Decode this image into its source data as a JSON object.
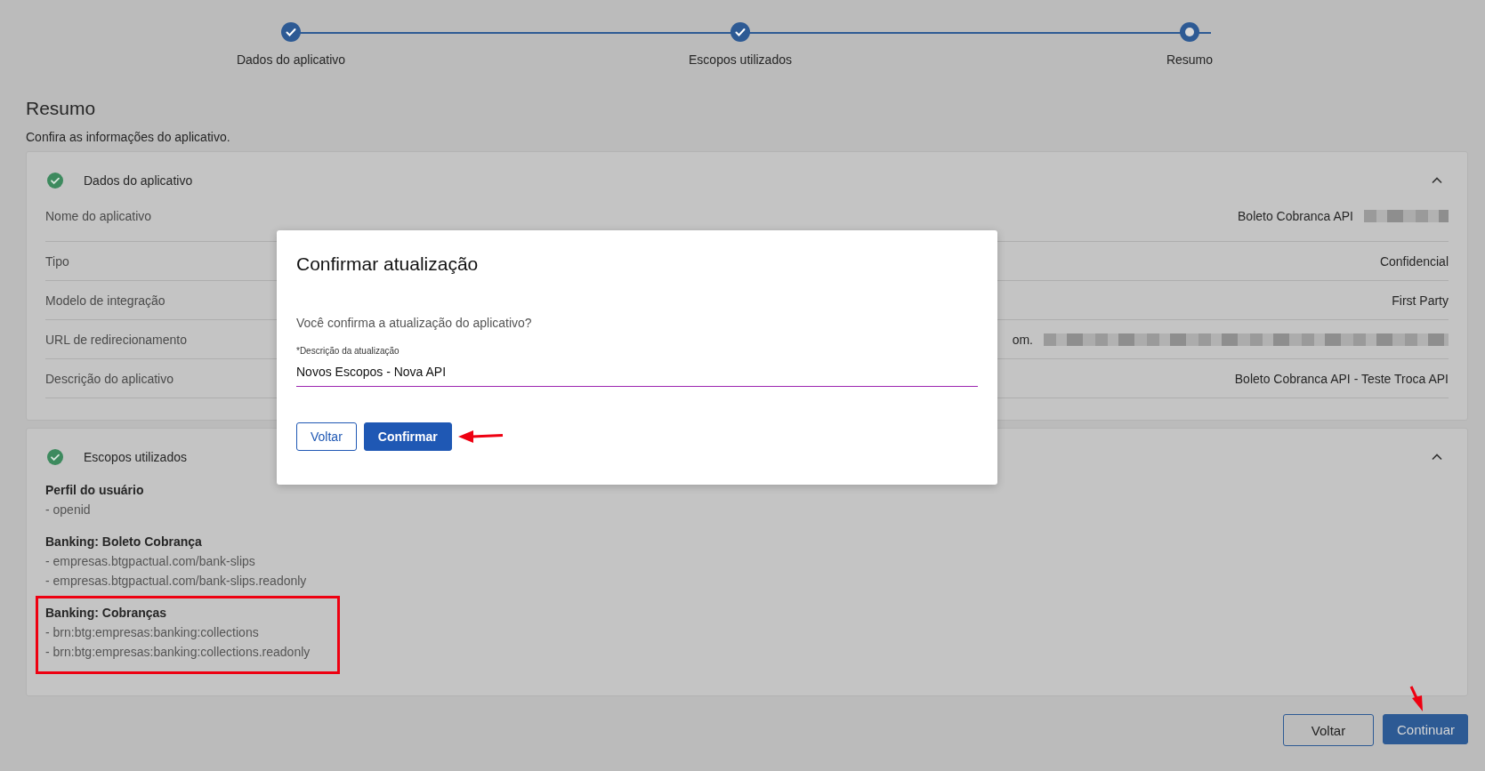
{
  "stepper": {
    "steps": [
      {
        "label": "Dados do aplicativo",
        "completed": true
      },
      {
        "label": "Escopos utilizados",
        "completed": true
      },
      {
        "label": "Resumo",
        "completed": false
      }
    ]
  },
  "page": {
    "title": "Resumo",
    "subtitle": "Confira as informações do aplicativo."
  },
  "sections": [
    {
      "kind": "fields",
      "title": "Dados do aplicativo",
      "complete": true,
      "expanded": true,
      "fields": [
        {
          "label": "Nome do aplicativo",
          "value": "Boleto Cobranca API",
          "redacted": true
        },
        {
          "label": "Tipo",
          "value": "Confidencial",
          "redacted": false
        },
        {
          "label": "Modelo de integração",
          "value": "First Party",
          "redacted": false
        },
        {
          "label": "URL de redirecionamento",
          "value": "om.",
          "redacted": true
        },
        {
          "label": "Descrição do aplicativo",
          "value": "Boleto Cobranca API - Teste Troca API",
          "redacted": false
        }
      ]
    },
    {
      "kind": "scopes",
      "title": "Escopos utilizados",
      "complete": true,
      "expanded": true,
      "groups": [
        {
          "title": "Perfil do usuário",
          "highlighted": false,
          "scopes": [
            "- openid"
          ]
        },
        {
          "title": "Banking: Boleto Cobrança",
          "highlighted": false,
          "scopes": [
            "- empresas.btgpactual.com/bank-slips",
            "- empresas.btgpactual.com/bank-slips.readonly"
          ]
        },
        {
          "title": "Banking: Cobranças",
          "highlighted": true,
          "scopes": [
            "- brn:btg:empresas:banking:collections",
            "- brn:btg:empresas:banking:collections.readonly"
          ]
        }
      ]
    }
  ],
  "actions": [
    {
      "label": "Voltar",
      "kind": "secondary",
      "pointed": false
    },
    {
      "label": "Continuar",
      "kind": "primary",
      "pointed": true
    }
  ],
  "dialog": {
    "title": "Confirmar atualização",
    "message": "Você confirma a atualização do aplicativo?",
    "field": {
      "label": "*Descrição da atualização",
      "value": "Novos Escopos - Nova API"
    },
    "buttons": [
      {
        "label": "Voltar",
        "kind": "secondary",
        "pointed": false
      },
      {
        "label": "Confirmar",
        "kind": "primary",
        "pointed": true
      }
    ]
  }
}
